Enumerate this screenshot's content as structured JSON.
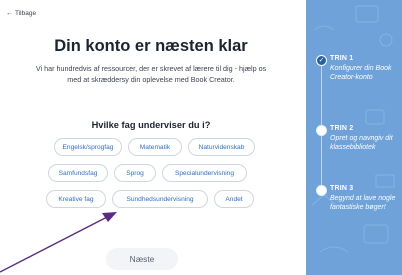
{
  "back_link": {
    "label": "Tilbage",
    "icon": "arrow-left-icon"
  },
  "title": "Din konto er næsten klar",
  "intro": "Vi har hundredvis af ressourcer, der er skrevet af lærere til dig - hjælp os med at skræddersy din oplevelse med Book Creator.",
  "question": "Hvilke fag underviser du i?",
  "subjects": [
    "Engelsk/sprogfag",
    "Matematik",
    "Naturvidenskab",
    "Samfundsfag",
    "Sprog",
    "Specialundervisning",
    "Kreative fag",
    "Sundhedsundervisning",
    "Andet"
  ],
  "next_button": "Næste",
  "steps": [
    {
      "label": "TRIN 1",
      "desc": "Konfigurer din Book Creator-konto",
      "status": "done",
      "icon": "check-icon"
    },
    {
      "label": "TRIN 2",
      "desc": "Opret og navngiv dit klassebibliotek",
      "status": "todo"
    },
    {
      "label": "TRIN 3",
      "desc": "Begynd at lave nogle fantastiske bøger!",
      "status": "todo"
    }
  ],
  "colors": {
    "accent": "#2f6fc9",
    "sidebar": "#6ea2d9",
    "step_done": "#2a5da8",
    "pointer_arrow": "#5b2a86"
  }
}
